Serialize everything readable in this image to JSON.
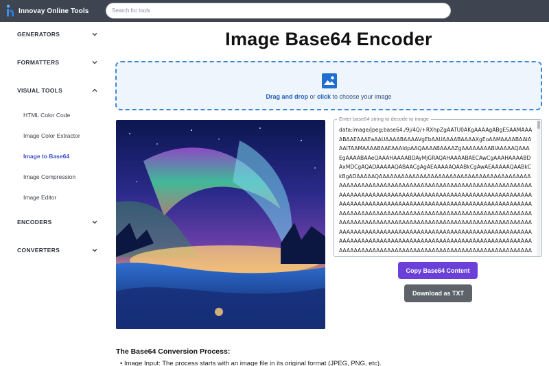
{
  "header": {
    "brand": "Innovay Online Tools",
    "search_placeholder": "Search for tools",
    "logo_icon": "innovay-logo-icon"
  },
  "sidebar": {
    "sections": [
      {
        "label": "GENERATORS",
        "expanded": false
      },
      {
        "label": "FORMATTERS",
        "expanded": false
      },
      {
        "label": "VISUAL TOOLS",
        "expanded": true
      },
      {
        "label": "ENCODERS",
        "expanded": false
      },
      {
        "label": "CONVERTERS",
        "expanded": false
      }
    ],
    "visual_tools_items": [
      {
        "label": "HTML Color Code",
        "active": false
      },
      {
        "label": "Image Color Extractor",
        "active": false
      },
      {
        "label": "Image to Base64",
        "active": true
      },
      {
        "label": "Image Compression",
        "active": false
      },
      {
        "label": "Image Editor",
        "active": false
      }
    ]
  },
  "main": {
    "title": "Image Base64 Encoder",
    "dropzone": {
      "text_bold1": "Drag and drop",
      "text_mid": " or ",
      "text_bold2": "click",
      "text_end": " to choose your image",
      "icon": "image-icon"
    },
    "textarea": {
      "label": "Enter base64 string to decode to image",
      "value": "data:image/jpeg;base64,/9j/4Q/+RXhpZgAATU0AKgAAAAgABgESAAMAAAABAAEAAAEaAAUAAAABAAAAVgEbAAUAAAABAAAAXgEoAAMAAAABAAIAAAITAAMAAAABAAEAAAIdpAAQAAAABAAAAZgAAAAAAAABIAAAAAQAAAEgAAAABAAeQAAAHAAAABDAyMjGRAQAHAAAABAECAwCgAAAHAAAABDAxMDCgAQADAAAAAQABAACgAgAEAAAAAQAABkCgAwAEAAAAAQAABkCkBgADAAAAAQAAAAAAAAAAAAAAAAAAAAAAAAAAAAAAAAAAAAAAAAAAAAAAAAAAAAAAAAAAAAAAAAAAAAAAAAAAAAAAAAAAAAAAAAAAAAAAAAAAAAAAAAAAAAAAAAAAAAAAAAAAAAAAAAAAAAAAAAAAAAAAAAAAAAAAAAAAAAAAAAAAAAAAAAAAAAAAAAAAAAAAAAAAAAAAAAAAAAAAAAAAAAAAAAAAAAAAAAAAAAAAAAAAAAAAAAAAAAAAAAAAAAAAAAAAAAAAAAAAAAAAAAAAAAAAAAAAAAAAAAAAAAAAAAAAAAAAAAAAAAAAAAAAAAAAAAAAAAAAAAAAAAAAAAAAAAAAAAAAAAAAAAAAAAAAAAAAAAAAAAAAAAAAAAAAAAAAAAAAAAAAAAAAAAAAAAAAAAAAAAAAAAAAAAAAAAAAAAAAAAAAAAAAAAAAAAAAAAAAAAAAAAAAAAAAAAAAAAAAAAAAAAAAAAAAAAAAAAAAAAAAAAAAAAAA"
    },
    "buttons": {
      "copy": "Copy Base64 Content",
      "download": "Download as TXT"
    },
    "section_heading": "The Base64 Conversion Process:",
    "bullet_1": "• Image Input: The process starts with an image file in its original format (JPEG, PNG, etc)."
  },
  "colors": {
    "topbar": "#3e4550",
    "accent_link": "#3b4fc4",
    "copy_button": "#6a40d8",
    "download_button": "#5d6369",
    "dropzone_border": "#3d86d6"
  }
}
